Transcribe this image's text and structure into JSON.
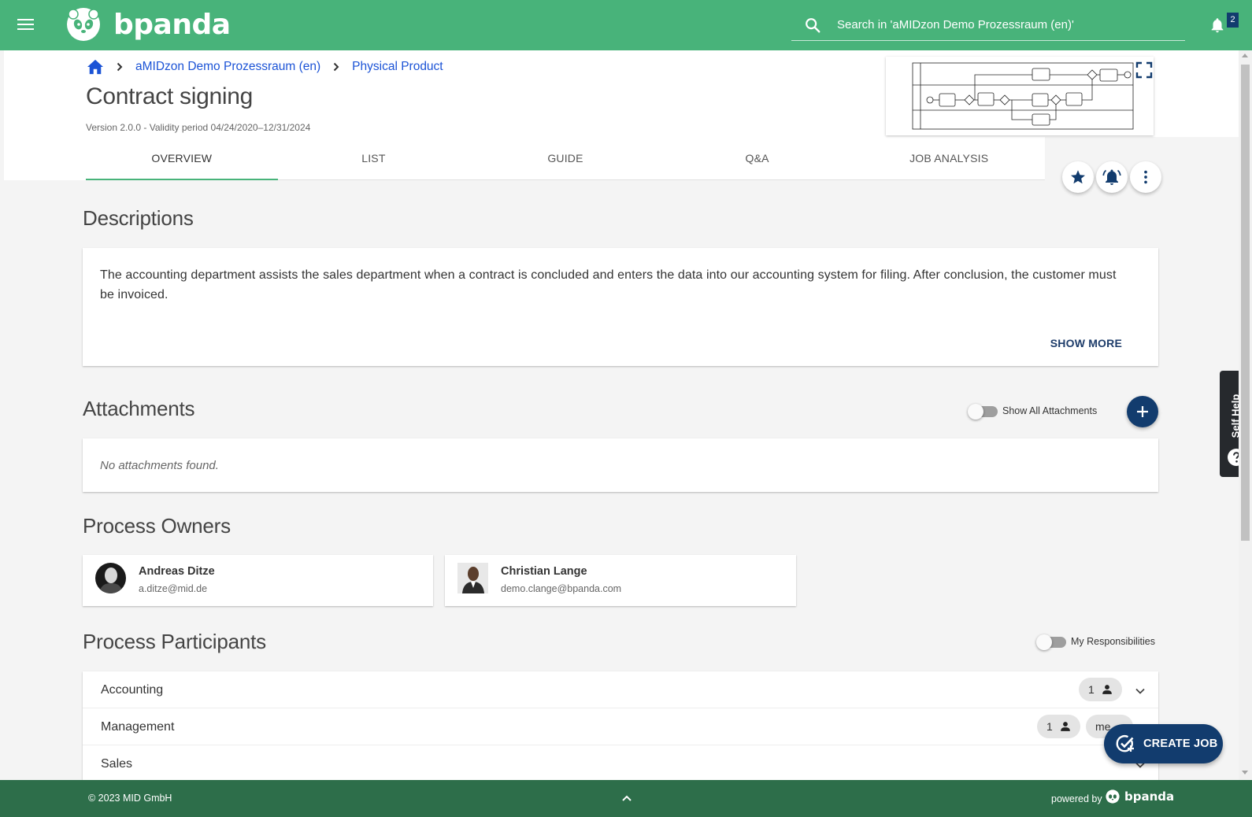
{
  "app": {
    "brand": "bpanda",
    "search_placeholder": "Search in 'aMIDzon Demo Prozessraum (en)'",
    "notification_count": "2",
    "colors": {
      "primary": "#48b37a",
      "accent": "#123c6e",
      "footer": "#2d6e4a"
    }
  },
  "breadcrumb": {
    "items": [
      {
        "label": "aMIDzon Demo Prozessraum (en)"
      },
      {
        "label": "Physical Product"
      }
    ]
  },
  "process": {
    "title": "Contract signing",
    "version": "Version 2.0.0 - Validity period 04/24/2020–12/31/2024"
  },
  "tabs": [
    {
      "label": "OVERVIEW",
      "active": true
    },
    {
      "label": "LIST"
    },
    {
      "label": "GUIDE"
    },
    {
      "label": "Q&A"
    },
    {
      "label": "JOB ANALYSIS"
    }
  ],
  "descriptions": {
    "title": "Descriptions",
    "text": "The accounting department assists the sales department when a contract is concluded and enters the data into our accounting system for filing. After conclusion, the customer must be invoiced.",
    "show_more": "SHOW MORE"
  },
  "attachments": {
    "title": "Attachments",
    "toggle_label": "Show All Attachments",
    "empty": "No attachments found."
  },
  "owners": {
    "title": "Process Owners",
    "items": [
      {
        "name": "Andreas Ditze",
        "email": "a.ditze@mid.de"
      },
      {
        "name": "Christian Lange",
        "email": "demo.clange@bpanda.com"
      }
    ]
  },
  "participants": {
    "title": "Process Participants",
    "toggle_label": "My Responsibilities",
    "items": [
      {
        "label": "Accounting",
        "count": "1"
      },
      {
        "label": "Management",
        "count": "1",
        "extra": "me"
      },
      {
        "label": "Sales"
      }
    ]
  },
  "create_job": "CREATE JOB",
  "self_help": "Self Help",
  "footer": {
    "copyright": "© 2023 MID GmbH",
    "powered_by": "powered by",
    "brand": "bpanda"
  }
}
